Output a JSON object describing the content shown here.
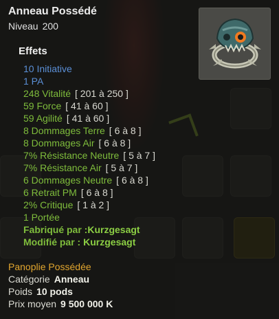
{
  "item": {
    "name": "Anneau Possédé",
    "level_label": "Niveau",
    "level_value": "200",
    "icon": "possessed-ring-icon"
  },
  "effects_title": "Effets",
  "effects": [
    {
      "text": "10 Initiative",
      "range": "",
      "color": "blue"
    },
    {
      "text": "1 PA",
      "range": "",
      "color": "blue"
    },
    {
      "text": "248 Vitalité",
      "range": "[ 201 à 250 ]",
      "color": "green"
    },
    {
      "text": "59 Force",
      "range": "[ 41 à 60 ]",
      "color": "green"
    },
    {
      "text": "59 Agilité",
      "range": "[ 41 à 60 ]",
      "color": "green"
    },
    {
      "text": "8 Dommages Terre",
      "range": "[ 6 à 8 ]",
      "color": "green"
    },
    {
      "text": "8 Dommages Air",
      "range": "[ 6 à 8 ]",
      "color": "green"
    },
    {
      "text": "7% Résistance Neutre",
      "range": "[ 5 à 7 ]",
      "color": "green"
    },
    {
      "text": "7% Résistance Air",
      "range": "[ 5 à 7 ]",
      "color": "green"
    },
    {
      "text": "6 Dommages Neutre",
      "range": "[ 6 à 8 ]",
      "color": "green"
    },
    {
      "text": "6 Retrait PM",
      "range": "[ 6 à 8 ]",
      "color": "green"
    },
    {
      "text": "2% Critique",
      "range": "[ 1 à 2 ]",
      "color": "green"
    },
    {
      "text": "1 Portée",
      "range": "",
      "color": "green"
    }
  ],
  "crafted_label": "Fabriqué par :",
  "crafted_by": "Kurzgesagt",
  "modified_label": "Modifié par :",
  "modified_by": "Kurzgesagt",
  "set_name": "Panoplie Possédée",
  "category_label": "Catégorie",
  "category_value": "Anneau",
  "weight_label": "Poids",
  "weight_value": "10 pods",
  "price_label": "Prix moyen",
  "price_value": "9 500 000 K",
  "colors": {
    "blue": "#5b8fd6",
    "green": "#7fbd3c",
    "set": "#e3a72f",
    "background": "#1c1c1a"
  }
}
